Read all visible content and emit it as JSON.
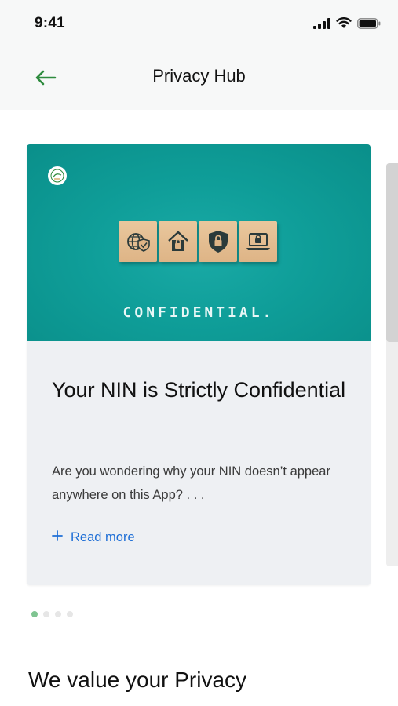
{
  "status_bar": {
    "time": "9:41",
    "icons": [
      "cellular-signal-icon",
      "wifi-icon",
      "battery-icon"
    ]
  },
  "header": {
    "back_icon": "arrow-left-icon",
    "title": "Privacy Hub"
  },
  "carousel": {
    "cards": [
      {
        "image_caption": "CONFIDENTIAL.",
        "image_icons": [
          "globe-shield-icon",
          "house-lock-icon",
          "shield-lock-icon",
          "laptop-lock-icon"
        ],
        "title": "Your NIN is Strictly Confidential",
        "description": "Are you wondering why your NIN doesn’t appear anywhere on this App? . . .",
        "read_more_label": "Read more"
      }
    ],
    "page_count": 4,
    "active_index": 0
  },
  "section": {
    "title": "We value your Privacy"
  },
  "colors": {
    "accent_green": "#2e8b3e",
    "teal": "#0f9e99",
    "link_blue": "#1f6fd6",
    "dot_active": "#7fc491"
  }
}
